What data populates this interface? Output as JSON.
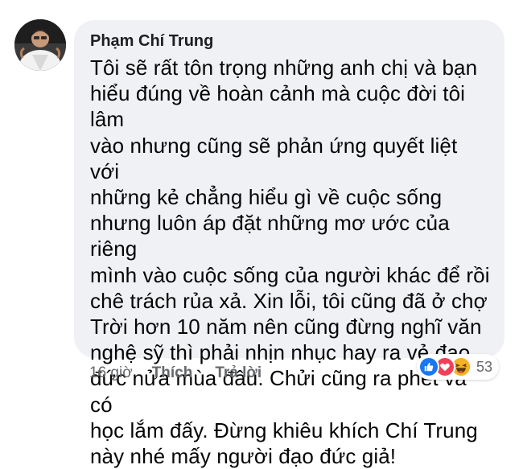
{
  "comment": {
    "author": "Phạm Chí Trung",
    "text": "Tôi sẽ rất tôn trọng những anh chị và bạn\nhiểu đúng về hoàn cảnh mà cuộc đời tôi lâm\nvào nhưng cũng sẽ phản ứng quyết liệt với\nnhững kẻ chẳng hiểu gì về cuộc sống\nnhưng luôn áp đặt những mơ ước của riêng\nmình vào cuộc sống của người khác để rồi\nchê trách rủa xả. Xin lỗi, tôi cũng đã ở chợ\nTrời hơn 10 năm nên cũng đừng nghĩ văn\nnghệ sỹ thì phải nhịn nhục hay ra vẻ đạo\nđức nửa mùa đâu. Chửi cũng ra phết và có\nhọc lắm đấy. Đừng khiêu khích Chí Trung\nnày nhé mấy người đạo đức giả!"
  },
  "actions": {
    "time": "16 giờ",
    "like_label": "Thích",
    "reply_label": "Trả lời"
  },
  "reactions": {
    "types": [
      "like-icon",
      "love-icon",
      "haha-icon"
    ],
    "count": "53",
    "colors": {
      "like": "#1877f2",
      "love": "#f33e58",
      "haha": "#f7b125"
    }
  },
  "colors": {
    "bubble": "#eff1f4",
    "secondary_text": "#65676b",
    "primary_text": "#050505"
  }
}
